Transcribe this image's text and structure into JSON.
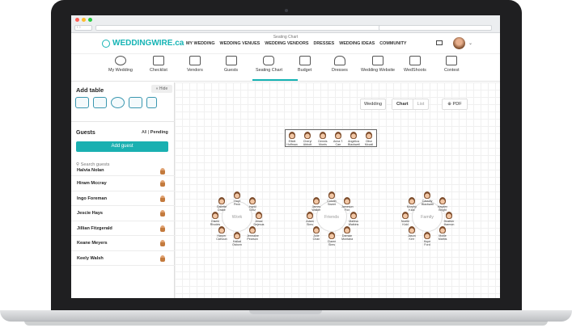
{
  "browser": {
    "title": "Seating Chart",
    "dots": [
      "#ff5f57",
      "#febc2e",
      "#28c840"
    ]
  },
  "brand": {
    "name": "WEDDINGWIRE.ca",
    "color": "#16b4b5"
  },
  "top_menu": [
    "MY WEDDING",
    "WEDDING VENUES",
    "WEDDING VENDORS",
    "DRESSES",
    "WEDDING IDEAS",
    "COMMUNITY"
  ],
  "subnav": [
    "My Wedding",
    "Checklist",
    "Vendors",
    "Guests",
    "Seating Chart",
    "Budget",
    "Dresses",
    "Wedding Website",
    "WedShoots",
    "Contest"
  ],
  "sidebar": {
    "add_table": "Add table",
    "hide": "« Hide",
    "guests_title": "Guests",
    "filter_all": "All",
    "filter_pending": "Pending",
    "add_guest": "Add guest",
    "search_placeholder": "Search guests",
    "guest_list": [
      "Halvia Nolan",
      "Hiram Mccray",
      "Ingo Foreman",
      "Jescie Hays",
      "Jillian Fitzgerald",
      "Keane Meyers",
      "Keely Walsh"
    ]
  },
  "toolbar": {
    "wedding": "Wedding",
    "chart": "Chart",
    "list": "List",
    "pdf": "PDF"
  },
  "head_table": [
    "Elliott Hoffman",
    "Cheryl Abbott",
    "Dennis Morris",
    "Anna T. Carr",
    "Angelica Blackwell",
    "Olive Mccall"
  ],
  "round_tables": [
    {
      "name": "Work",
      "guests": [
        "Hoyt Peck",
        "Ingrid Ortiz",
        "Jesse Dejesus",
        "Jermaine Pearson",
        "Hallad Osborn",
        "Harper Calhoun",
        "Gisele Rhodes",
        "Gallette Drake"
      ]
    },
    {
      "name": "Friends",
      "guests": [
        "Colorin Sweet",
        "Jameson Fox",
        "Mallina Watkins",
        "Damian Montana",
        "Claren Sims",
        "Julie Chan",
        "Adam Sims",
        "James Walker"
      ]
    },
    {
      "name": "Family",
      "guests": [
        "Cassidy Blackwell",
        "Hayden Bright",
        "Heather Harmon",
        "Mollie Mathis",
        "Hope Ford",
        "Jason Kerr",
        "Noelle Kidd",
        "Murphy Kidd"
      ]
    }
  ]
}
